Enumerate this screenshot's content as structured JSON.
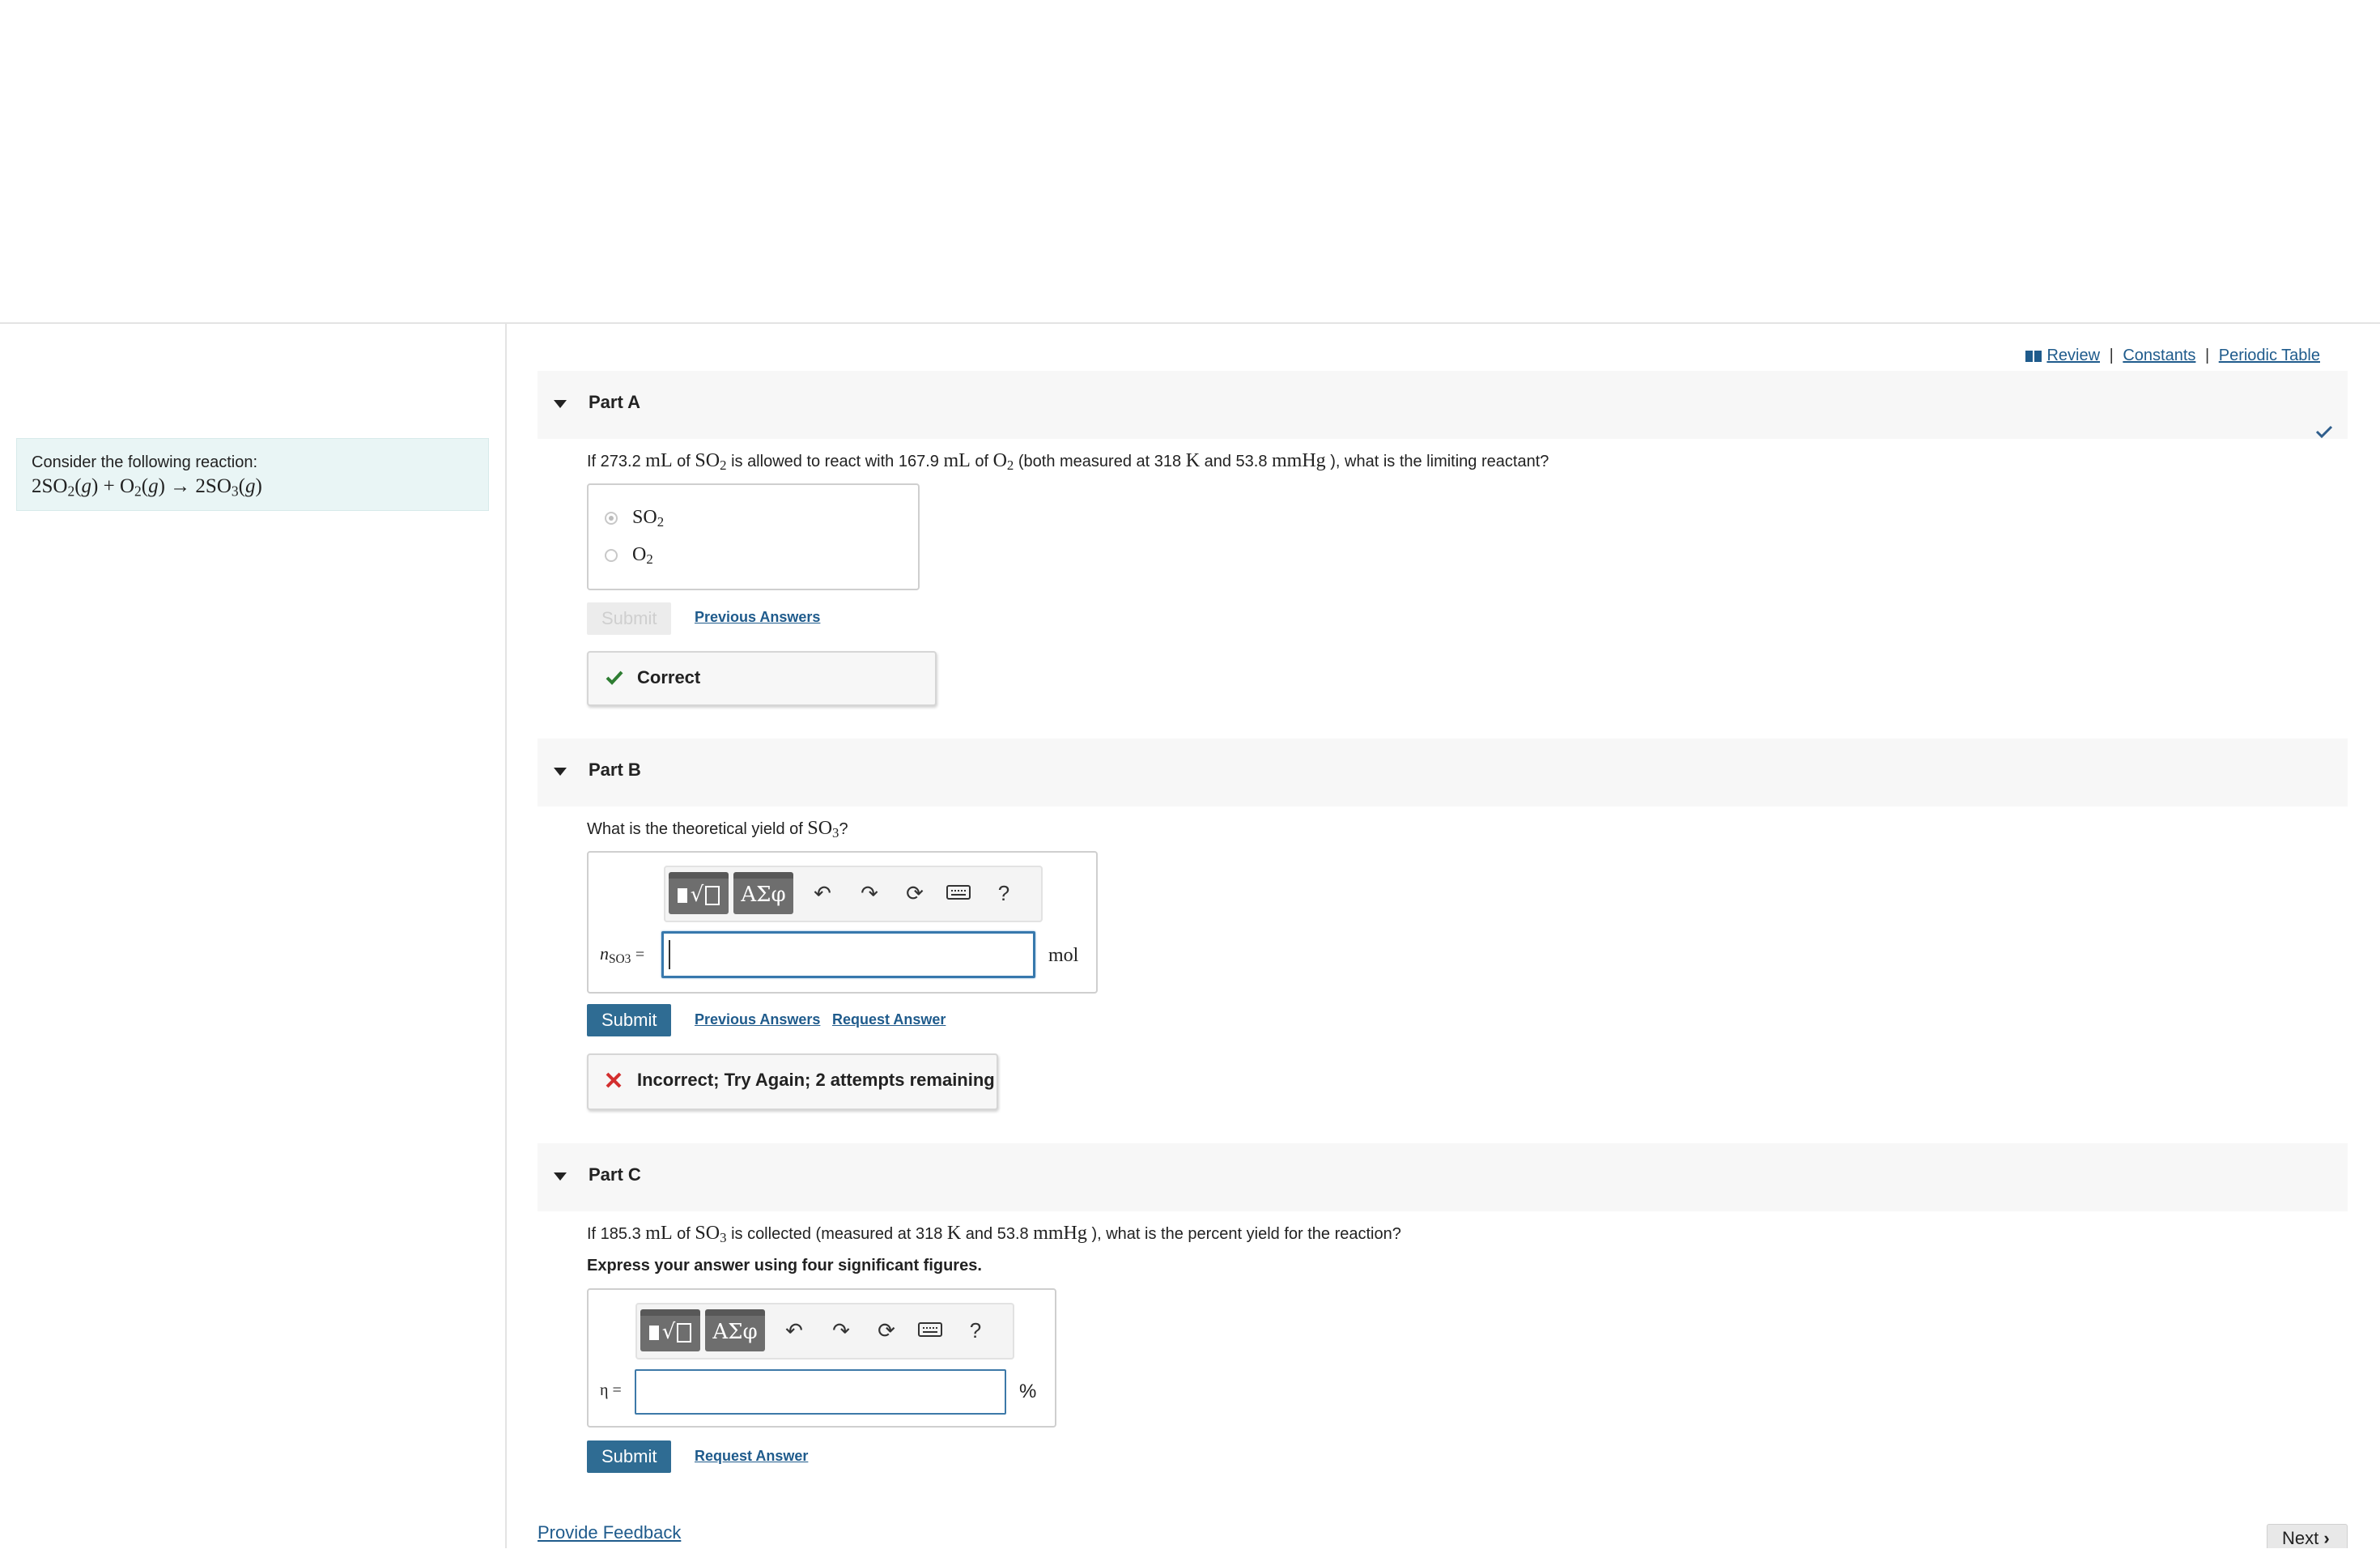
{
  "resources": {
    "review": "Review",
    "constants": "Constants",
    "periodic_table": "Periodic Table",
    "sep": "|"
  },
  "intro": {
    "text": "Consider the following reaction:",
    "equation": "2SO2(g) + O2(g) → 2SO3(g)"
  },
  "part_a": {
    "title": "Part A",
    "q_prefix": "If 273.2",
    "q_mid1": "of",
    "q_mid2": "is allowed to react with 167.9",
    "q_mid3": "of",
    "q_mid4": "(both measured at 318",
    "q_mid5": "and 53.8",
    "q_suffix": "), what is the limiting reactant?",
    "unit_ml": "mL",
    "unit_k": "K",
    "unit_mmhg": "mmHg",
    "options": [
      "SO2",
      "O2"
    ],
    "selected": "SO2",
    "submit_label": "Submit",
    "previous_answers": "Previous Answers",
    "feedback": "Correct"
  },
  "part_b": {
    "title": "Part B",
    "q_prefix": "What is the theoretical yield of",
    "q_suffix": "?",
    "toolbar": {
      "templates": "√",
      "symbols": "ΑΣφ",
      "help": "?"
    },
    "var_label": "n",
    "var_sub": "SO3",
    "equals": "=",
    "input_value": "",
    "unit": "mol",
    "submit_label": "Submit",
    "previous_answers": "Previous Answers",
    "request_answer": "Request Answer",
    "feedback": "Incorrect; Try Again; 2 attempts remaining"
  },
  "part_c": {
    "title": "Part C",
    "q_prefix": "If 185.3",
    "q_mid1": "of",
    "q_mid2": "is collected (measured at 318",
    "q_mid3": "and 53.8",
    "q_suffix": "), what is the percent yield for the reaction?",
    "instruction": "Express your answer using four significant figures.",
    "toolbar": {
      "templates": "√",
      "symbols": "ΑΣφ",
      "help": "?"
    },
    "var_label": "η =",
    "input_value": "",
    "unit": "%",
    "submit_label": "Submit",
    "request_answer": "Request Answer"
  },
  "footer": {
    "provide_feedback": "Provide Feedback",
    "next": "Next"
  },
  "colors": {
    "accent": "#2f6c93",
    "link": "#1f5b8c",
    "correct": "#2e7d32",
    "incorrect": "#d32f2f",
    "intro_bg": "#e9f5f5"
  }
}
